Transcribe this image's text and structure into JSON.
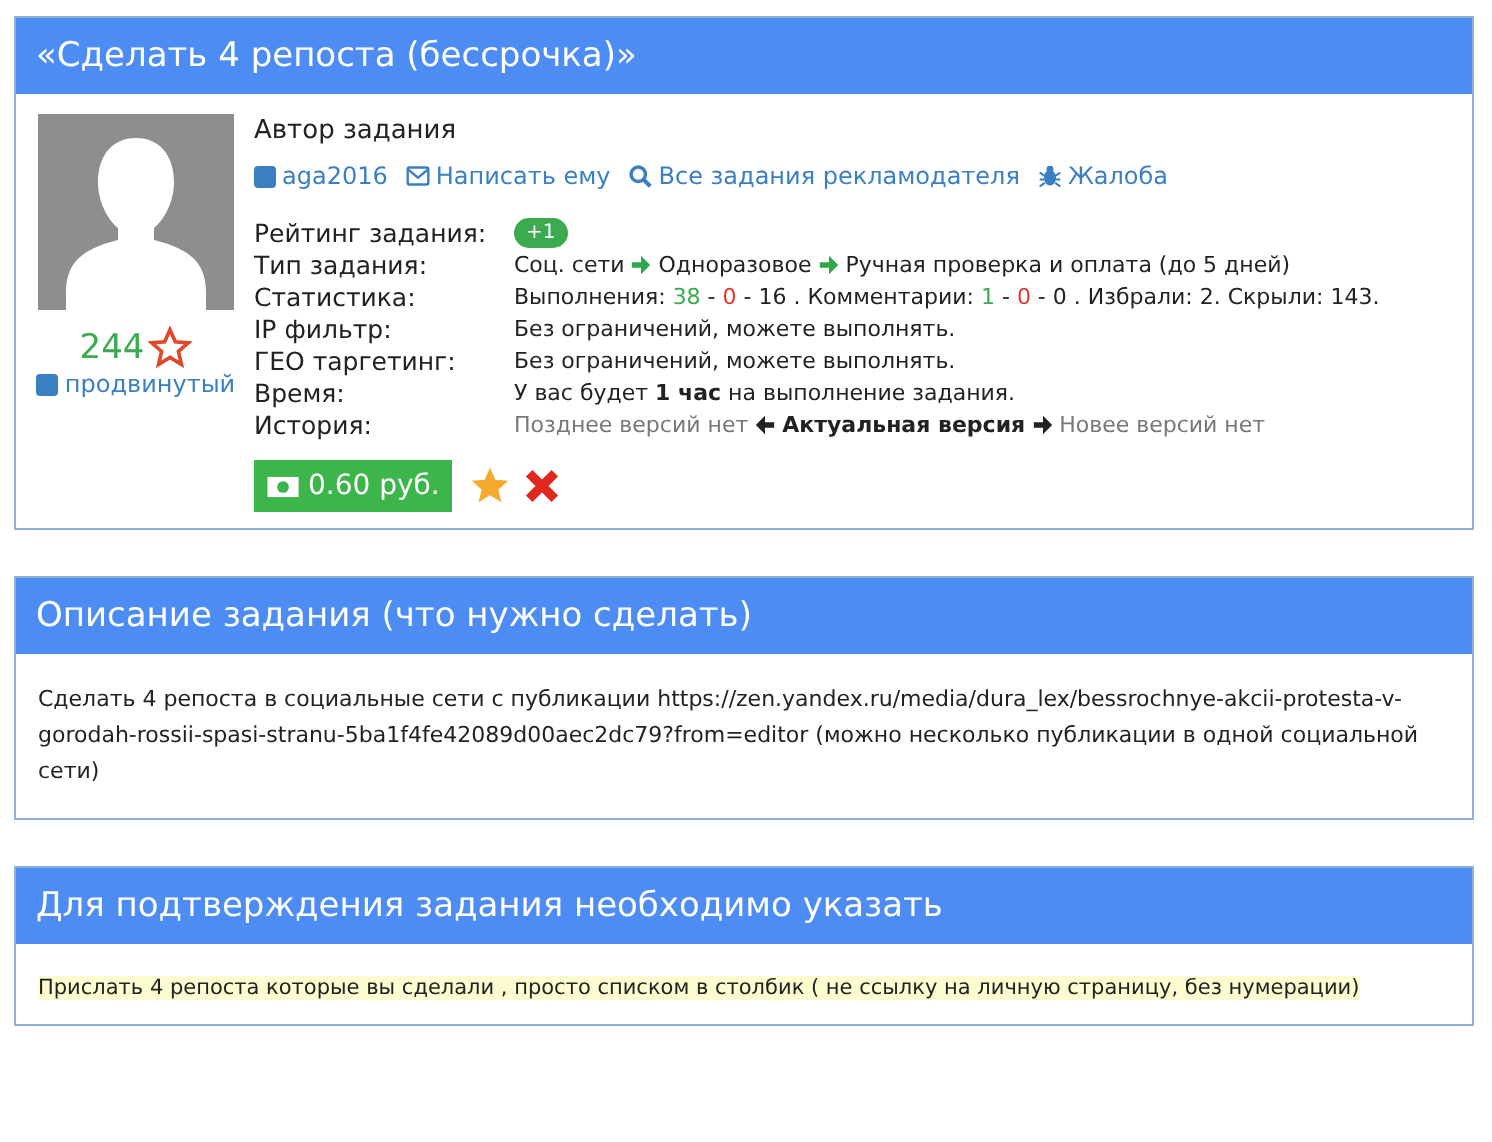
{
  "task": {
    "title": "«Сделать 4 репоста (бессрочка)»",
    "author": {
      "heading": "Автор задания",
      "score": "244",
      "level": "продвинутый",
      "links": [
        {
          "kind": "user",
          "label": "aga2016"
        },
        {
          "kind": "message",
          "label": "Написать ему"
        },
        {
          "kind": "search",
          "label": "Все задания рекламодателя"
        },
        {
          "kind": "complaint",
          "label": "Жалоба"
        }
      ]
    },
    "rating": {
      "label": "Рейтинг задания:",
      "badge": "+1"
    },
    "type": {
      "label": "Тип задания:",
      "steps": [
        "Соц. сети",
        "Одноразовое",
        "Ручная проверка и оплата (до 5 дней)"
      ]
    },
    "stats": {
      "label": "Статистика:",
      "parts": [
        {
          "kind": "plain",
          "text": "Выполнения: "
        },
        {
          "kind": "good",
          "text": "38"
        },
        {
          "kind": "plain",
          "text": " - "
        },
        {
          "kind": "bad",
          "text": "0"
        },
        {
          "kind": "plain",
          "text": " - 16 . Комментарии: "
        },
        {
          "kind": "good",
          "text": "1"
        },
        {
          "kind": "plain",
          "text": " - "
        },
        {
          "kind": "bad",
          "text": "0"
        },
        {
          "kind": "plain",
          "text": " - 0 . Избрали: 2. Скрыли: 143."
        }
      ]
    },
    "rows": [
      {
        "label": "IP фильтр:",
        "value": "Без ограничений, можете выполнять."
      },
      {
        "label": "ГЕО таргетинг:",
        "value": "Без ограничений, можете выполнять."
      },
      {
        "label": "Время:",
        "value": "У вас будет **1 час** на выполнение задания."
      }
    ],
    "history": {
      "label": "История:",
      "older": "Позднее версий нет",
      "current": "Актуальная версия",
      "newer": "Новее версий нет"
    },
    "price": "0.60 руб."
  },
  "description": {
    "title": "Описание задания (что нужно сделать)",
    "text": "Сделать 4 репоста в социальные сети с публикации https://zen.yandex.ru/media/dura_lex/bessrochnye-akcii-protesta-v-gorodah-rossii-spasi-stranu-5ba1f4fe42089d00aec2dc79?from=editor (можно несколько публикации в одной социальной сети)"
  },
  "confirmation": {
    "title": "Для подтверждения задания необходимо указать",
    "text": "Прислать 4 репоста которые вы сделали , просто списком в столбик ( не ссылку на личную страницу, без нумерации)"
  }
}
